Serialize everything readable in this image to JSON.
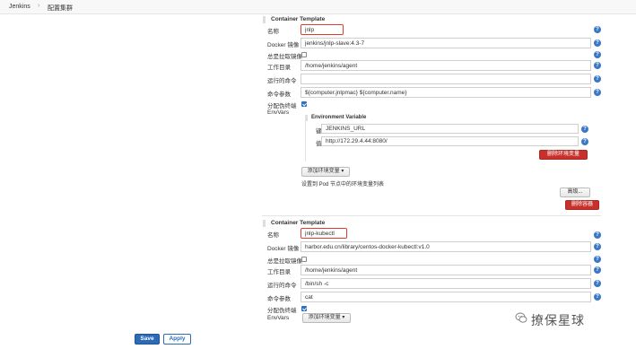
{
  "breadcrumb": {
    "home": "Jenkins",
    "separator": "›",
    "current": "配置集群"
  },
  "sidebar_text": "— —  —",
  "containers": [
    {
      "title": "Container Template",
      "name_label": "名称",
      "name_value": "jnlp",
      "image_label": "Docker 镜像",
      "image_value": "jenkins/jnlp-slave:4.3-7",
      "always_pull_label": "总是拉取镜像",
      "always_pull": false,
      "workdir_label": "工作目录",
      "workdir_value": "/home/jenkins/agent",
      "command_label": "运行的命令",
      "command_value": "",
      "args_label": "命令参数",
      "args_value": "${computer.jnlpmac} ${computer.name}",
      "tty_label": "分配伪终端",
      "tty": true,
      "envvars_label": "EnvVars",
      "env_var": {
        "title": "Environment Variable",
        "key_label": "键",
        "key_value": "JENKINS_URL",
        "value_label": "值",
        "value_value": "http://172.29.4.44:8080/",
        "delete_label": "删除环境变量"
      },
      "add_env_label": "添加环境变量 ▾",
      "env_note": "设置到 Pod 节点中的环境变量列表",
      "advanced_label": "高级...",
      "delete_container_label": "删除容器"
    },
    {
      "title": "Container Template",
      "name_label": "名称",
      "name_value": "jnlp-kubectl",
      "image_label": "Docker 镜像",
      "image_value": "harbor.edu.cn/library/centos-docker-kubectl:v1.0",
      "always_pull_label": "总是拉取镜像",
      "always_pull": false,
      "workdir_label": "工作目录",
      "workdir_value": "/home/jenkins/agent",
      "command_label": "运行的命令",
      "command_value": "/bin/sh -c",
      "args_label": "命令参数",
      "args_value": "cat",
      "tty_label": "分配伪终端",
      "tty": true,
      "envvars_label": "EnvVars",
      "add_env_label": "添加环境变量 ▾"
    }
  ],
  "help_glyph": "?",
  "footer": {
    "save_label": "Save",
    "apply_label": "Apply"
  },
  "watermark": "撩保星球",
  "colors": {
    "highlight_border": "#e23b2e",
    "danger_button": "#c9302c",
    "primary_button": "#2c6bb5",
    "help_icon": "#3b78c4"
  }
}
